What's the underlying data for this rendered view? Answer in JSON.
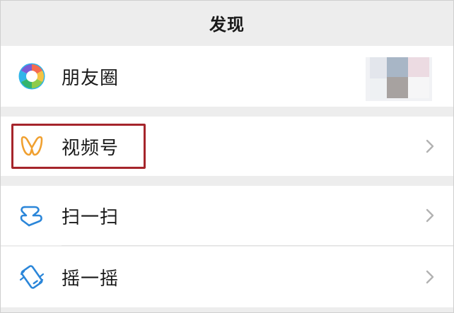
{
  "header": {
    "title": "发现"
  },
  "menu": {
    "items": [
      {
        "label": "朋友圈",
        "icon": "moments-aperture-icon"
      },
      {
        "label": "视频号",
        "icon": "channels-butterfly-icon"
      },
      {
        "label": "扫一扫",
        "icon": "scan-icon"
      },
      {
        "label": "摇一摇",
        "icon": "shake-icon"
      }
    ]
  },
  "colors": {
    "background": "#ededed",
    "cell": "#ffffff",
    "highlight": "#a5252b",
    "channels_icon": "#f0a030",
    "tool_icon": "#2b86d9"
  }
}
